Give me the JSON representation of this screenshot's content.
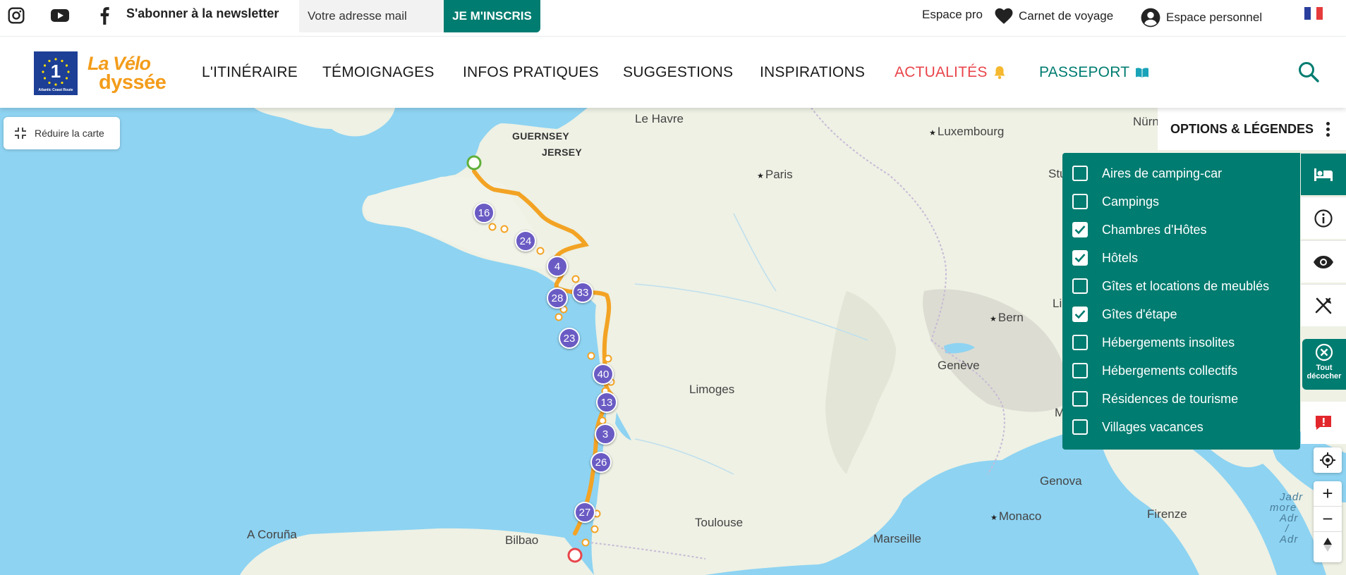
{
  "topbar": {
    "newsletter_label": "S'abonner à la newsletter",
    "email_placeholder": "Votre adresse mail",
    "subscribe_label": "JE M'INSCRIS",
    "espace_pro": "Espace pro",
    "carnet": "Carnet de voyage",
    "espace_perso": "Espace personnel"
  },
  "brand": {
    "eu_number": "1",
    "eu_caption": "Atlantic Coast Route",
    "name_line1": "La Vélo",
    "name_line2": "dyssée"
  },
  "nav": {
    "items": [
      "L'ITINÉRAIRE",
      "TÉMOIGNAGES",
      "INFOS PRATIQUES",
      "SUGGESTIONS",
      "INSPIRATIONS",
      "ACTUALITÉS",
      "PASSEPORT"
    ],
    "accent_red": "#e8454b",
    "accent_green": "#007c70"
  },
  "map": {
    "reduce_label": "Réduire la carte",
    "options_title": "OPTIONS & LÉGENDES",
    "uncheck_line1": "Tout",
    "uncheck_line2": "décocher",
    "labels": {
      "guernsey": "GUERNSEY",
      "jersey": "JERSEY",
      "le_havre": "Le Havre",
      "luxembourg": "Luxembourg",
      "nurnberg": "Nürn",
      "paris": "Paris",
      "stuttgart": "Stu",
      "bern": "Bern",
      "li": "Li",
      "geneve": "Genève",
      "limoges": "Limoges",
      "m": "M",
      "genova": "Genova",
      "monaco": "Monaco",
      "firenze": "Firenze",
      "toulouse": "Toulouse",
      "marseille": "Marseille",
      "a_coruna": "A Coruña",
      "bilbao": "Bilbao",
      "adriatic": [
        "Jadr",
        "more",
        "Adr",
        "/",
        "Adr"
      ]
    },
    "clusters": [
      "16",
      "24",
      "4",
      "33",
      "28",
      "23",
      "40",
      "13",
      "3",
      "26",
      "27"
    ],
    "legend": [
      {
        "label": "Aires de camping-car",
        "checked": false
      },
      {
        "label": "Campings",
        "checked": false
      },
      {
        "label": "Chambres d'Hôtes",
        "checked": true
      },
      {
        "label": "Hôtels",
        "checked": true
      },
      {
        "label": "Gîtes et locations de meublés",
        "checked": false
      },
      {
        "label": "Gîtes d'étape",
        "checked": true
      },
      {
        "label": "Hébergements insolites",
        "checked": false
      },
      {
        "label": "Hébergements collectifs",
        "checked": false
      },
      {
        "label": "Résidences de tourisme",
        "checked": false
      },
      {
        "label": "Villages vacances",
        "checked": false
      }
    ]
  }
}
